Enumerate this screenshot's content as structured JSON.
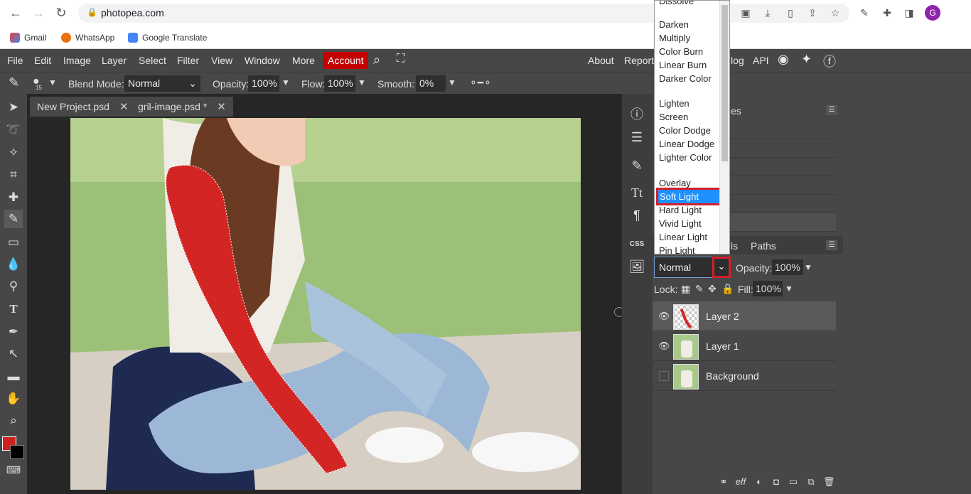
{
  "browser": {
    "url": "photopea.com",
    "bookmarks": [
      "Gmail",
      "WhatsApp",
      "Google Translate"
    ],
    "profile_initial": "G"
  },
  "menubar": {
    "items": [
      "File",
      "Edit",
      "Image",
      "Layer",
      "Select",
      "Filter",
      "View",
      "Window",
      "More"
    ],
    "account": "Account",
    "right_items": [
      "About",
      "Report",
      "log",
      "API"
    ]
  },
  "options": {
    "brush_size": "15",
    "blend_label": "Blend Mode:",
    "blend_value": "Normal",
    "opacity_label": "Opacity:",
    "opacity_value": "100%",
    "flow_label": "Flow:",
    "flow_value": "100%",
    "smooth_label": "Smooth:",
    "smooth_value": "0%"
  },
  "doc_tabs": [
    {
      "label": "New Project.psd"
    },
    {
      "label": "gril-image.psd *"
    }
  ],
  "panels": {
    "top_title_fragment": "es",
    "layers_tab_fragment": "ls",
    "paths_tab": "Paths",
    "layer_blend": "Normal",
    "opacity_label": "Opacity:",
    "opacity_value": "100%",
    "lock_label": "Lock:",
    "fill_label": "Fill:",
    "fill_value": "100%",
    "layers": [
      {
        "name": "Layer 2",
        "visible": true,
        "selected": true
      },
      {
        "name": "Layer 1",
        "visible": true,
        "selected": false
      },
      {
        "name": "Background",
        "visible": false,
        "selected": false
      }
    ]
  },
  "dropdown": {
    "top_cut": "Dissolve",
    "groups": [
      [
        "Darken",
        "Multiply",
        "Color Burn",
        "Linear Burn",
        "Darker Color"
      ],
      [
        "Lighten",
        "Screen",
        "Color Dodge",
        "Linear Dodge",
        "Lighter Color"
      ],
      [
        "Overlay",
        "Soft Light",
        "Hard Light",
        "Vivid Light",
        "Linear Light",
        "Pin Light"
      ]
    ],
    "selected": "Soft Light"
  },
  "colors": {
    "accent": "#c40000",
    "highlight": "#d21f2b",
    "selection": "#1e90ff",
    "foreground": "#d02020",
    "background": "#000000"
  }
}
